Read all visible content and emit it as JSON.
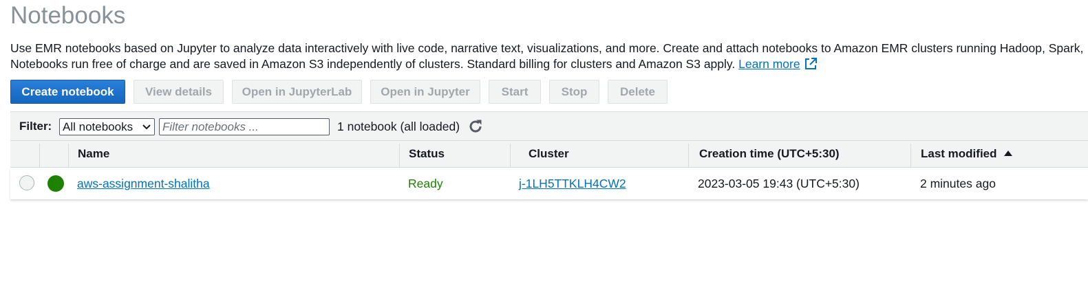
{
  "page": {
    "title": "Notebooks",
    "description_line1": "Use EMR notebooks based on Jupyter to analyze data interactively with live code, narrative text, visualizations, and more. Create and attach notebooks to Amazon EMR clusters running Hadoop, Spark, and Livy.",
    "description_line2": "Notebooks run free of charge and are saved in Amazon S3 independently of clusters. Standard billing for clusters and Amazon S3 apply.",
    "learn_more": "Learn more"
  },
  "toolbar": {
    "create": "Create notebook",
    "view_details": "View details",
    "open_jupyterlab": "Open in JupyterLab",
    "open_jupyter": "Open in Jupyter",
    "start": "Start",
    "stop": "Stop",
    "delete": "Delete"
  },
  "filter": {
    "label": "Filter:",
    "selected": "All notebooks",
    "placeholder": "Filter notebooks ...",
    "count": "1 notebook (all loaded)"
  },
  "table": {
    "headers": {
      "name": "Name",
      "status": "Status",
      "cluster": "Cluster",
      "created": "Creation time (UTC+5:30)",
      "modified": "Last modified"
    },
    "sort": {
      "column": "Last modified",
      "direction": "ascending"
    },
    "rows": [
      {
        "name": "aws-assignment-shalitha",
        "status": "Ready",
        "cluster": "j-1LH5TTKLH4CW2",
        "created": "2023-03-05 19:43 (UTC+5:30)",
        "modified": "2 minutes ago",
        "status_color": "#1d8102"
      }
    ]
  },
  "colors": {
    "title": "#879196",
    "primary": "#1a6dc9",
    "link": "#0073bb",
    "ready": "#1d8102",
    "header_bg": "#f2f3f3"
  },
  "icons": {
    "external_link": "external-link-icon",
    "refresh": "refresh-icon",
    "sort": "sort-ascending-icon",
    "dropdown": "chevron-down-icon"
  }
}
